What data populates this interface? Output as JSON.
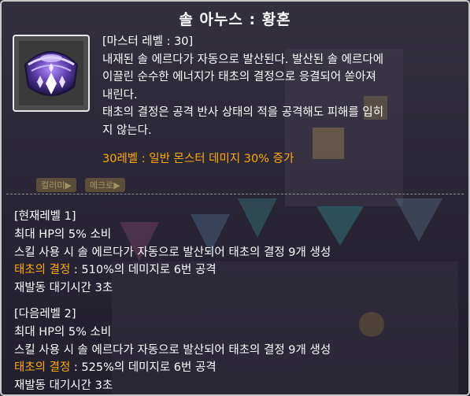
{
  "skill": {
    "name": "솔 아누스 : 황혼",
    "icon": "sol-janus-dusk-skill-icon",
    "master_level": "[마스터 레벨 : 30]",
    "description": [
      "내재된 솔 에르다가 자동으로 발산된다. 발산된 솔 에르다에",
      "이끌린 순수한 에너지가 태초의 결정으로 응결되어 쏟아져",
      "내린다.",
      "태초의 결정은 공격 반사 상태의 적을 공격해도 피해를 입히",
      "지 않는다."
    ],
    "bonus": "30레벨 : 일반 몬스터 데미지 30% 증가"
  },
  "background_buttons": [
    "컬러미▶",
    "메크로▶"
  ],
  "current_level": {
    "header": "[현재레벨 1]",
    "lines": [
      "최대 HP의 5% 소비",
      "스킬 사용 시 솔 에르다가 자동으로 발산되어 태초의 결정 9개 생성"
    ],
    "highlight_label": "태초의 결정",
    "highlight_rest": " : 510%의 데미지로 6번 공격",
    "cooldown": "재발동 대기시간 3초"
  },
  "next_level": {
    "header": "[다음레벨 2]",
    "lines": [
      "최대 HP의 5% 소비",
      "스킬 사용 시 솔 에르다가 자동으로 발산되어 태초의 결정 9개 생성"
    ],
    "highlight_label": "태초의 결정",
    "highlight_rest": " : 525%의 데미지로 6번 공격",
    "cooldown": "재발동 대기시간 3초"
  },
  "colors": {
    "text": "#ffffff",
    "highlight": "#ffaa00",
    "border": "#c9c9c9",
    "background": "#34303e"
  }
}
